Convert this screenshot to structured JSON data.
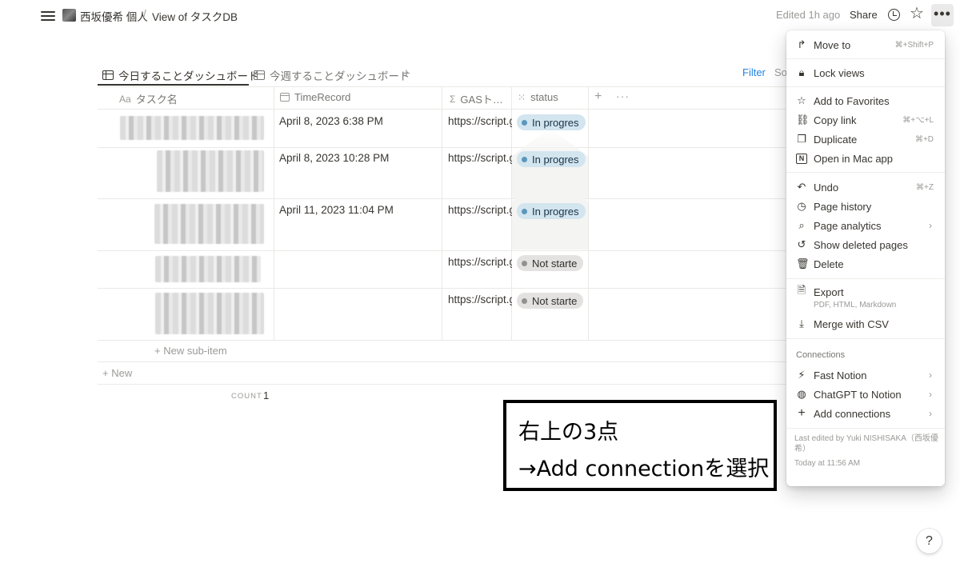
{
  "topbar": {
    "breadcrumb_workspace": "西坂優希 個人",
    "breadcrumb_sep": "/",
    "breadcrumb_page": "View of タスクDB",
    "edited": "Edited 1h ago",
    "share": "Share",
    "more": "•••"
  },
  "views": {
    "active_tab": "今日することダッシュボード",
    "second_tab": "今週することダッシュボード",
    "add": "+",
    "filter": "Filter",
    "sort": "So"
  },
  "table": {
    "columns": [
      "タスク名",
      "TimeRecord",
      "GASト…",
      "status"
    ],
    "column_icons": [
      "Aa",
      "calendar-icon",
      "Σ",
      "status-icon"
    ],
    "rows": [
      {
        "time": "April 8, 2023 6:38 PM",
        "url": "https://script.google.com",
        "status": "In progres",
        "status_kind": "in-progress"
      },
      {
        "time": "April 8, 2023 10:28 PM",
        "url": "https://script.google.com",
        "status": "In progres",
        "status_kind": "in-progress"
      },
      {
        "time": "April 11, 2023 11:04 PM",
        "url": "https://script.google.com",
        "status": "In progres",
        "status_kind": "in-progress"
      },
      {
        "time": "",
        "url": "https://script.google.com",
        "status": "Not starte",
        "status_kind": "not-started"
      },
      {
        "time": "",
        "url": "https://script.google.com",
        "status": "Not starte",
        "status_kind": "not-started"
      }
    ],
    "new_sub_item": "New sub-item",
    "new": "New",
    "count_label": "COUNT",
    "count_value": "1"
  },
  "annotation": {
    "line1": "右上の3点",
    "line2": "→Add connectionを選択"
  },
  "menu": {
    "move_to": "Move to",
    "move_to_sc": "⌘+Shift+P",
    "lock_views": "Lock views",
    "add_favorites": "Add to Favorites",
    "copy_link": "Copy link",
    "copy_link_sc": "⌘+⌥+L",
    "duplicate": "Duplicate",
    "duplicate_sc": "⌘+D",
    "open_mac": "Open in Mac app",
    "undo": "Undo",
    "undo_sc": "⌘+Z",
    "page_history": "Page history",
    "page_analytics": "Page analytics",
    "show_deleted": "Show deleted pages",
    "delete": "Delete",
    "export": "Export",
    "export_desc": "PDF, HTML, Markdown",
    "merge_csv": "Merge with CSV",
    "connections_header": "Connections",
    "fast_notion": "Fast Notion",
    "chatgpt_notion": "ChatGPT to Notion",
    "add_connections": "Add connections",
    "last_edited": "Last edited by Yuki NISHISAKA（西坂優希）",
    "last_edited_time": "Today at 11:56 AM"
  },
  "help": "?",
  "colors": {
    "accent": "#2383e2",
    "in_progress_bg": "#d3e5ef",
    "not_started_bg": "#e3e2e0",
    "text": "#37352f"
  }
}
